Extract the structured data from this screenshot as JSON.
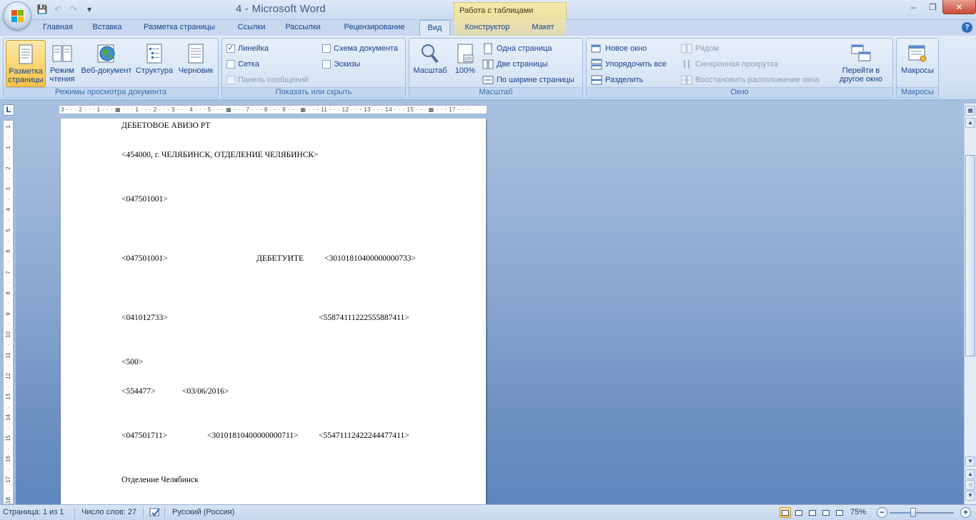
{
  "window": {
    "title": "4 - Microsoft Word",
    "context_tab_title": "Работа с таблицами",
    "minimize": "–",
    "maximize": "❐",
    "close": "✕"
  },
  "qat": {
    "save": "💾",
    "undo": "↶",
    "redo": "↷",
    "customize": "▾"
  },
  "tabs": [
    {
      "label": "Главная"
    },
    {
      "label": "Вставка"
    },
    {
      "label": "Разметка страницы"
    },
    {
      "label": "Ссылки"
    },
    {
      "label": "Рассылки"
    },
    {
      "label": "Рецензирование"
    },
    {
      "label": "Вид"
    },
    {
      "label": "Конструктор"
    },
    {
      "label": "Макет"
    }
  ],
  "active_tab": "Вид",
  "help": "?",
  "ribbon": {
    "doc_views": {
      "label": "Режимы просмотра документа",
      "print_layout": "Разметка страницы",
      "reading": "Режим чтения",
      "web": "Веб-документ",
      "outline": "Структура",
      "draft": "Черновик"
    },
    "show_hide": {
      "label": "Показать или скрыть",
      "ruler": "Линейка",
      "ruler_checked": true,
      "grid": "Сетка",
      "message_bar": "Панель сообщений",
      "doc_map": "Схема документа",
      "thumbnails": "Эскизы"
    },
    "zoom": {
      "label": "Масштаб",
      "zoom": "Масштаб",
      "hundred": "100%",
      "one_page": "Одна страница",
      "two_pages": "Две страницы",
      "page_width": "По ширине страницы"
    },
    "window_grp": {
      "label": "Окно",
      "new_window": "Новое окно",
      "arrange_all": "Упорядочить все",
      "split": "Разделить",
      "side_by_side": "Рядом",
      "sync_scroll": "Синхронная прокрутка",
      "reset_pos": "Восстановить расположение окна",
      "switch_window": "Перейти в другое окно"
    },
    "macros": {
      "label": "Макросы",
      "macros": "Макросы"
    }
  },
  "ruler": {
    "corner": "L",
    "hticks": "3 · · · 2 · · · 1 · · · ▦ · · · 1 · · · 2 · · · 3 · · · 4 · · · 5 · · · ▦ · · · 7 · · · 8 · · · 9 · · · ▦ · · · 11 · · · 12 · · · 13 · · · 14 · · · 15 · · · ▦ · · · 17 · · ·",
    "vticks": [
      "1",
      "·",
      "1",
      "·",
      "2",
      "·",
      "3",
      "·",
      "4",
      "·",
      "5",
      "·",
      "6",
      "·",
      "7",
      "·",
      "8",
      "·",
      "9",
      "·",
      "10",
      "·",
      "11",
      "·",
      "12",
      "·",
      "13",
      "·",
      "14",
      "·",
      "15",
      "·",
      "16",
      "·",
      "17",
      "·",
      "18"
    ]
  },
  "document": {
    "lines": [
      {
        "text": "ДЕБЕТОВОЕ АВИЗО РТ"
      },
      {
        "text": "<454000, г. ЧЕЛЯБИНСК, ОТДЕЛЕНИЕ ЧЕЛЯБИНСК>"
      },
      {
        "text": "<047501001>"
      },
      {
        "text": "<047501001>"
      },
      {
        "text": "ДЕБЕТУИТЕ"
      },
      {
        "text": "<30101810400000000733>"
      },
      {
        "text": "<041012733>"
      },
      {
        "text": "<55874111222555887411>"
      },
      {
        "text": "<500>"
      },
      {
        "text": "<554477>"
      },
      {
        "text": "<03/06/2016>"
      },
      {
        "text": "<047501711>"
      },
      {
        "text": "<30101810400000000711>"
      },
      {
        "text": "<55471112422244477411>"
      },
      {
        "text": "Отделение Челябинск"
      }
    ]
  },
  "statusbar": {
    "page": "Страница: 1 из 1",
    "words": "Число слов: 27",
    "language": "Русский (Россия)",
    "zoom_pct": "75%",
    "zoom_value": 75,
    "zoom_minus": "−",
    "zoom_plus": "+"
  }
}
